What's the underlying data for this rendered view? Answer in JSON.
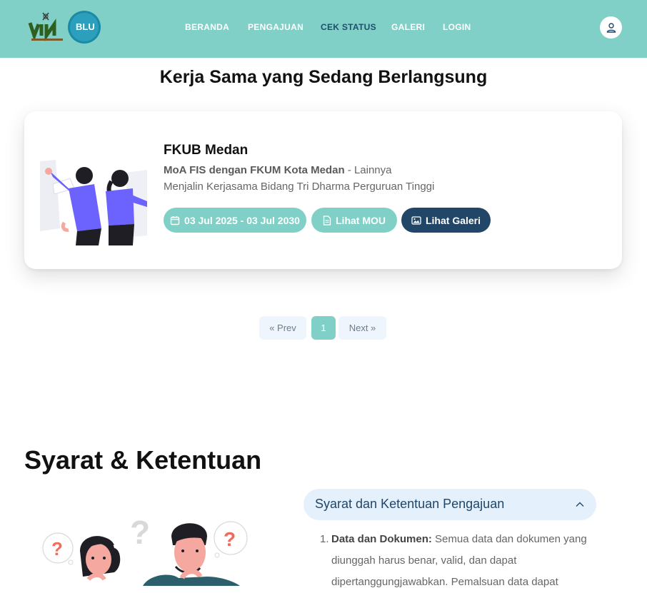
{
  "colors": {
    "header_bg": "#80d0c7",
    "nav_active": "#1e4e6e",
    "accent_teal": "#80d0c7",
    "accent_navy": "#214667",
    "accordion_bg": "#e5f0fd"
  },
  "header": {
    "logo_left_text": "UIN",
    "logo_right_text": "BLU",
    "nav": [
      {
        "label": "BERANDA"
      },
      {
        "label": "PENGAJUAN"
      },
      {
        "label": "CEK STATUS"
      },
      {
        "label": "GALERI"
      },
      {
        "label": "LOGIN"
      }
    ],
    "active_nav": "CEK STATUS",
    "user_icon": "user-icon"
  },
  "ongoing": {
    "title": "Kerja Sama yang Sedang Berlangsung",
    "cards": [
      {
        "name": "FKUB Medan",
        "agreement": "MoA FIS dengan FKUM Kota Medan",
        "category": "- Lainnya",
        "description": "Menjalin Kerjasama Bidang Tri Dharma Perguruan Tinggi",
        "date_range": "03 Jul 2025 - 03 Jul 2030",
        "mou_label": "Lihat MOU",
        "gallery_label": "Lihat Galeri"
      }
    ]
  },
  "pagination": {
    "prev": "« Prev",
    "current": "1",
    "next": "Next »"
  },
  "terms": {
    "title": "Syarat & Ketentuan",
    "accordion_title": "Syarat dan Ketentuan Pengajuan",
    "items": [
      {
        "number": "1.",
        "heading": "Data dan Dokumen:",
        "text": "Semua data dan dokumen yang diunggah harus benar, valid, dan dapat dipertanggungjawabkan. Pemalsuan data dapat"
      }
    ]
  }
}
